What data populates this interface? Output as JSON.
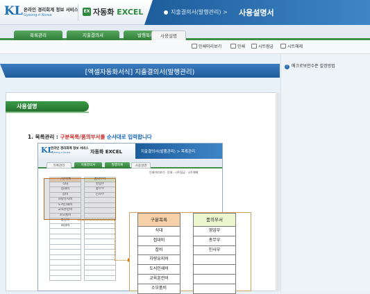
{
  "header": {
    "logo_text": "KL",
    "org_name": "온라인 경리회계 정보 서비스",
    "org_sub": "Gyeong-ri Korea",
    "brand_icon": "EX",
    "brand_ko": "자동화",
    "brand_en": "EXCEL",
    "path": "지출결의서(발행관리) >",
    "title": "사용설명서"
  },
  "tabs": [
    {
      "label": "목록관리"
    },
    {
      "label": "지출결의서"
    },
    {
      "label": "발행목록"
    },
    {
      "label": "사용설명"
    }
  ],
  "toolbar": {
    "preview": "인쇄미리보기",
    "print": "인쇄",
    "sheet_lock": "시트잠금",
    "sheet_unlock": "시트해제"
  },
  "main": {
    "title": "[엑셀자동화서식] 지출결의서(발행관리)",
    "section": "사용설명",
    "instruction": {
      "number": "1. 목록관리 :",
      "red": "구분목록/품의부서를",
      "blue": "순서대로 입력합니다"
    }
  },
  "inner": {
    "logo": "KL",
    "org": "온라인 경리회계 정보 서비스",
    "org_sub": "Gyeong-ri Korea",
    "brand": "자동화 EXCEL",
    "path": "지출결의서(발행관리) > 목록관리",
    "tabs": [
      "목록관리",
      "지출결의서",
      "발행목록",
      "사용설명"
    ],
    "toolbar": "인쇄미리보기 · 인쇄 · 시트잠금 · 시트해제",
    "left_col": [
      "구분목록",
      "식대",
      "접대비",
      "잡비",
      "차량유지비",
      "도서인쇄비",
      "교육훈련비",
      "소모품비",
      "통신비",
      "회의비",
      "",
      "",
      "",
      "",
      "",
      "",
      "",
      "",
      "",
      ""
    ],
    "right_col": [
      "품의부서",
      "영업부",
      "총무부",
      "인사부",
      "",
      "",
      "",
      "",
      "",
      "",
      "",
      "",
      "",
      "",
      "",
      "",
      "",
      "",
      "",
      ""
    ]
  },
  "zoom": {
    "left_header": "구분목록",
    "left_items": [
      "식대",
      "접대비",
      "잡비",
      "차량유지비",
      "도서인쇄비",
      "교육훈련비",
      "소모품비"
    ],
    "right_header": "품의부서",
    "right_items": [
      "영업부",
      "총무부",
      "인사부",
      "",
      "",
      "",
      ""
    ]
  },
  "side": {
    "help_label": "매크로보안수준 설정방법"
  },
  "colors": {
    "accent_green": "#2f7d38",
    "accent_blue": "#1f5b9a",
    "orange": "#e07b00"
  }
}
